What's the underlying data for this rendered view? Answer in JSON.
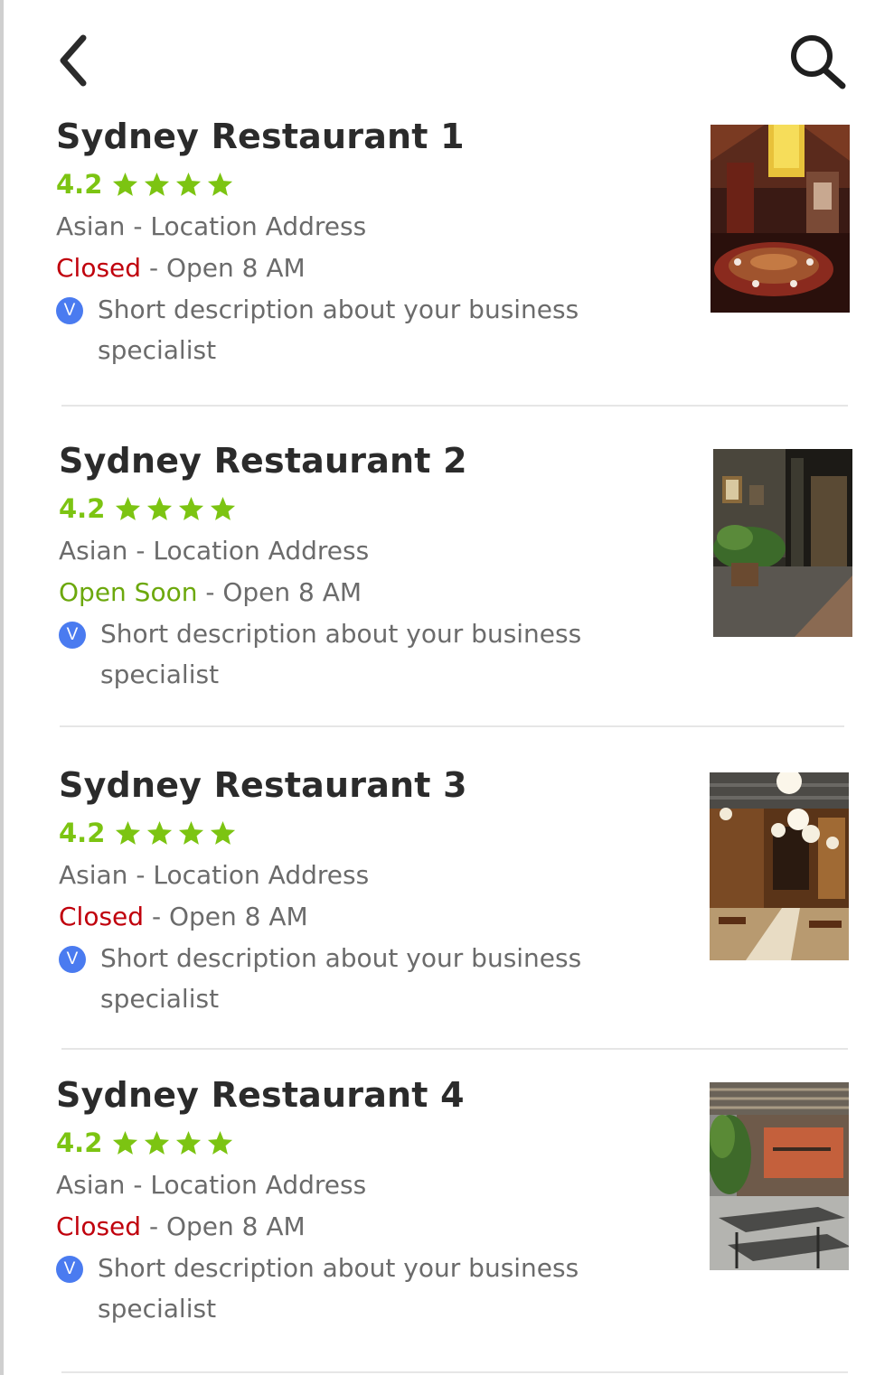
{
  "header": {
    "back_icon": "chevron-left-icon",
    "search_icon": "search-icon"
  },
  "colors": {
    "title": "#2b2b2b",
    "rating": "#7cc412",
    "closed": "#c0000c",
    "open_soon": "#6ca80c",
    "verified_badge": "#4a7bf0",
    "secondary_text": "#6b6b6b"
  },
  "restaurants": [
    {
      "name": "Sydney Restaurant 1",
      "rating": "4.2",
      "stars": 4,
      "category": "Asian - Location Address",
      "status": "Closed",
      "status_type": "closed",
      "hours": " - Open 8 AM",
      "badge": "V",
      "description": "Short description about your business specialist"
    },
    {
      "name": "Sydney Restaurant 2",
      "rating": "4.2",
      "stars": 4,
      "category": "Asian - Location Address",
      "status": "Open Soon",
      "status_type": "open_soon",
      "hours": " - Open 8 AM",
      "badge": "V",
      "description": "Short description about your business specialist"
    },
    {
      "name": "Sydney Restaurant 3",
      "rating": "4.2",
      "stars": 4,
      "category": "Asian - Location Address",
      "status": "Closed",
      "status_type": "closed",
      "hours": " - Open 8 AM",
      "badge": "V",
      "description": "Short description about your business specialist"
    },
    {
      "name": "Sydney Restaurant 4",
      "rating": "4.2",
      "stars": 4,
      "category": "Asian - Location Address",
      "status": "Closed",
      "status_type": "closed",
      "hours": " - Open 8 AM",
      "badge": "V",
      "description": "Short description about your business specialist"
    }
  ]
}
